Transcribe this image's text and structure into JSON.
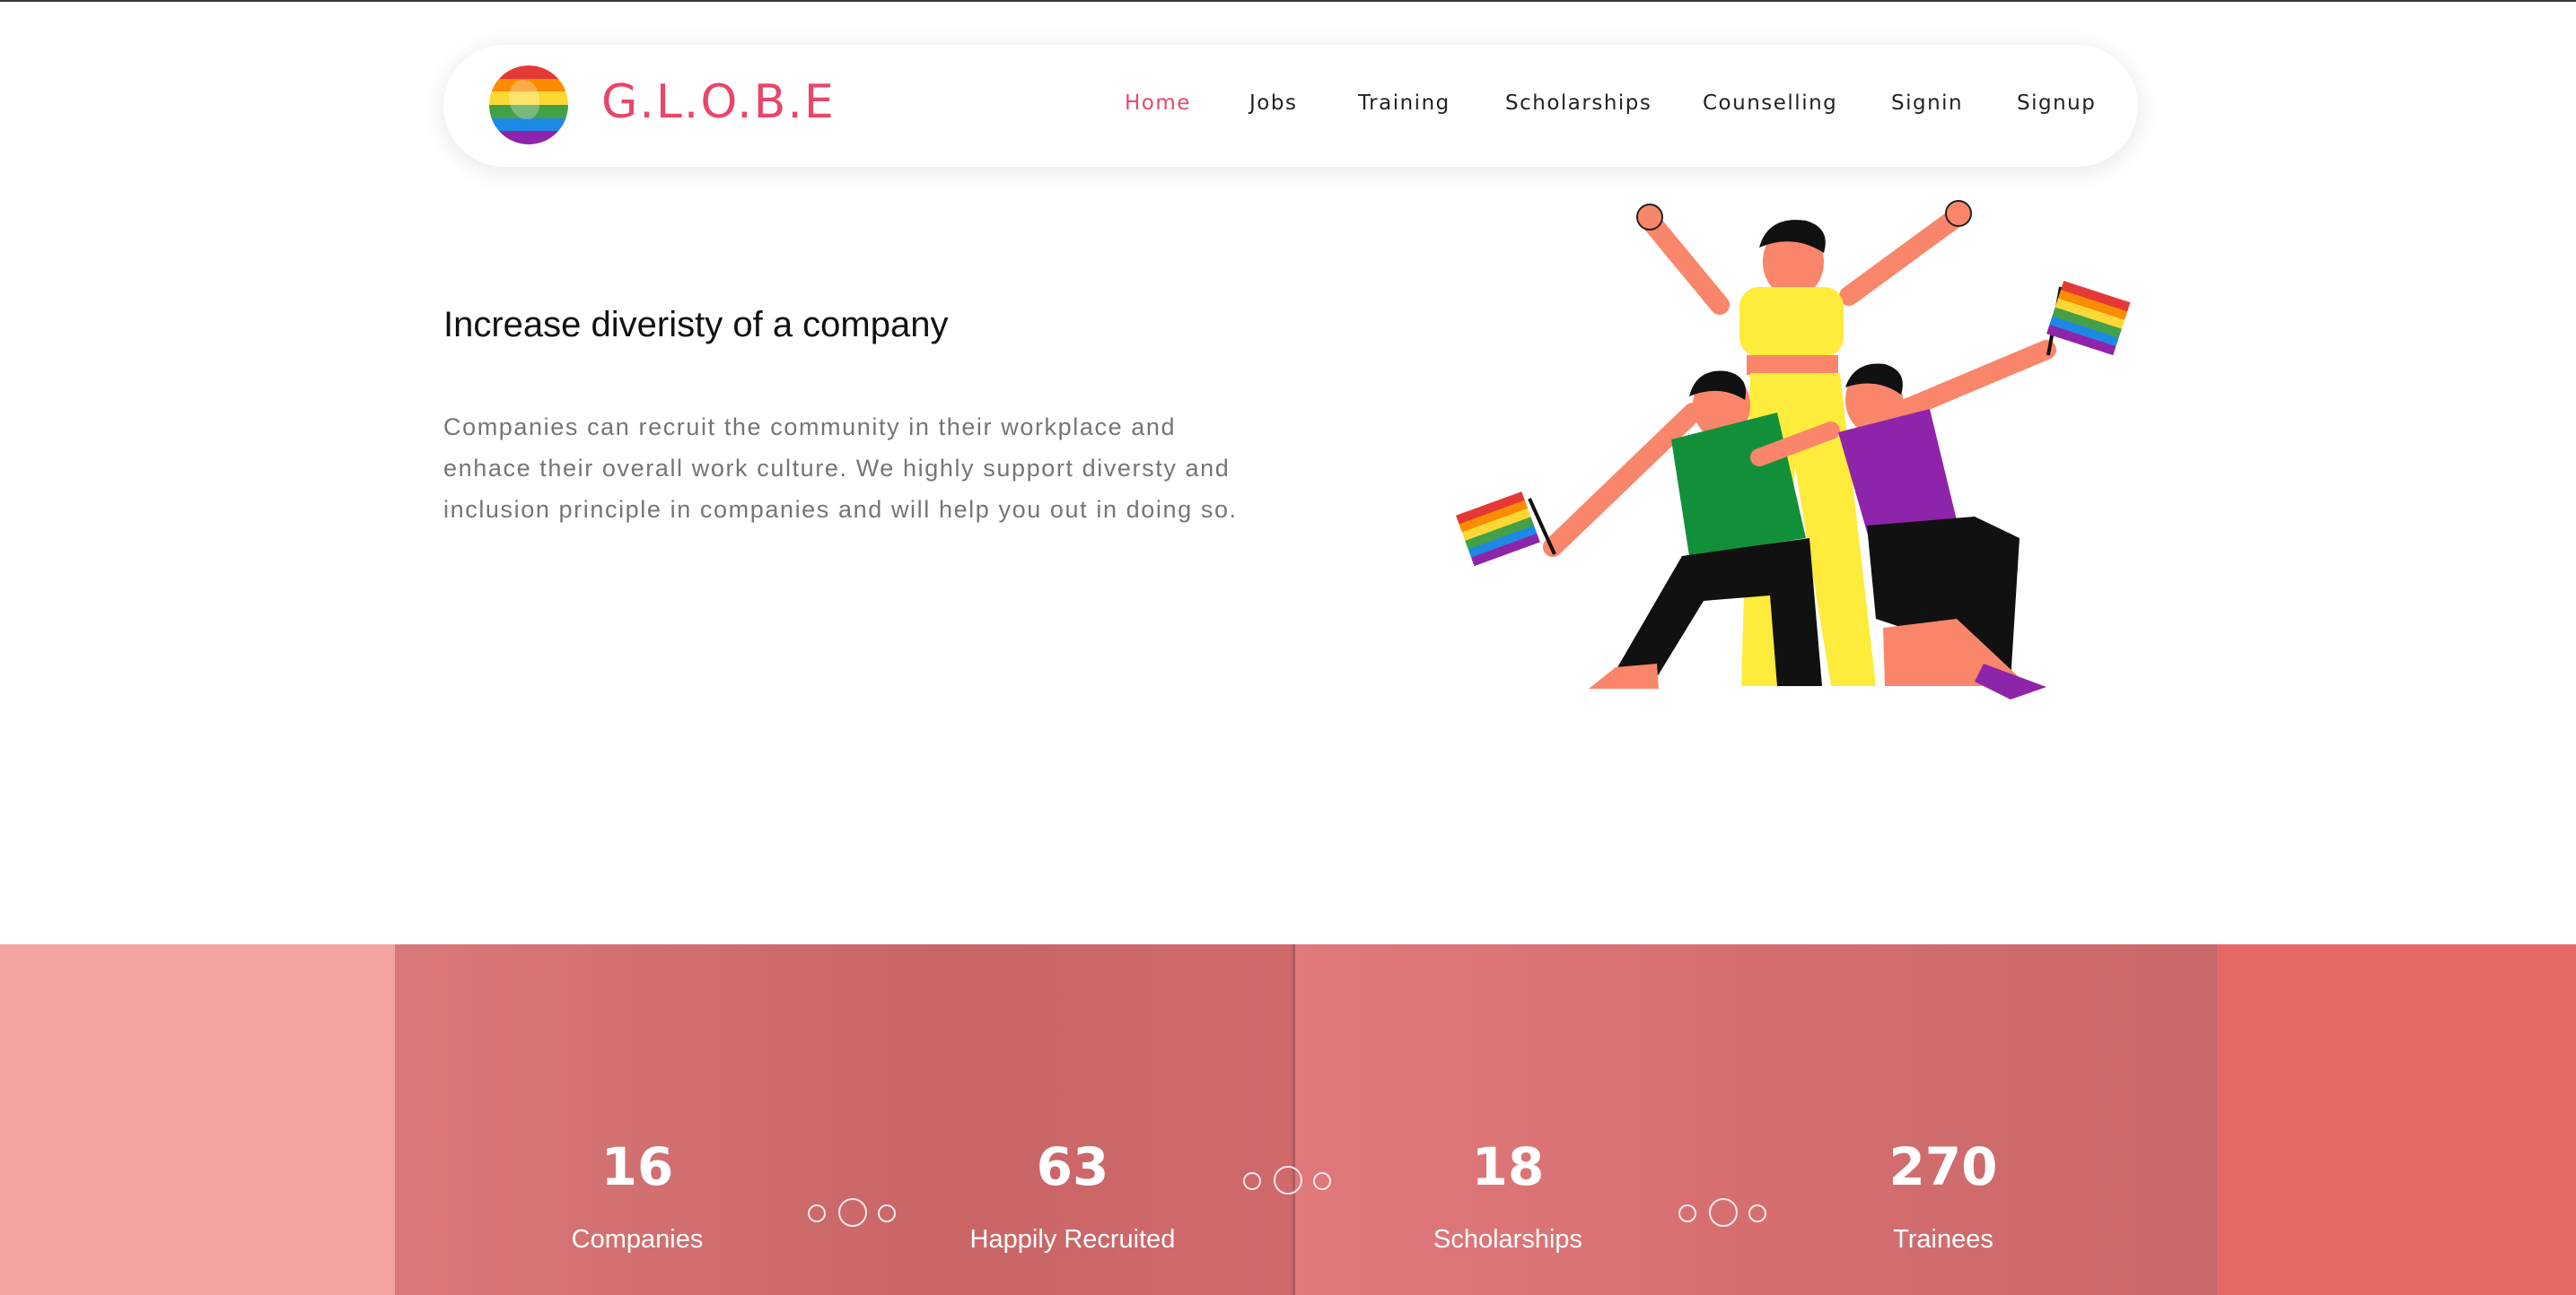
{
  "brand": {
    "name": "G.L.O.B.E",
    "logo_icon": "rainbow-globe-icon"
  },
  "nav": {
    "items": [
      {
        "label": "Home",
        "active": true
      },
      {
        "label": "Jobs",
        "active": false
      },
      {
        "label": "Training",
        "active": false
      },
      {
        "label": "Scholarships",
        "active": false
      },
      {
        "label": "Counselling",
        "active": false
      },
      {
        "label": "Signin",
        "active": false
      },
      {
        "label": "Signup",
        "active": false
      }
    ]
  },
  "hero": {
    "title": "Increase diveristy of a company",
    "text": "Companies can recruit the community in their workplace and enhace their overall work culture. We highly support diversty and inclusion principle in companies and will help you out in doing so.",
    "illustration": "pride-people-illustration"
  },
  "stats": [
    {
      "value": "16",
      "label": "Companies"
    },
    {
      "value": "63",
      "label": "Happily Recruited"
    },
    {
      "value": "18",
      "label": "Scholarships"
    },
    {
      "value": "270",
      "label": "Trainees"
    }
  ],
  "colors": {
    "accent": "#e9466a",
    "stats_overlay": "#e46f73",
    "text_muted": "#757575"
  }
}
